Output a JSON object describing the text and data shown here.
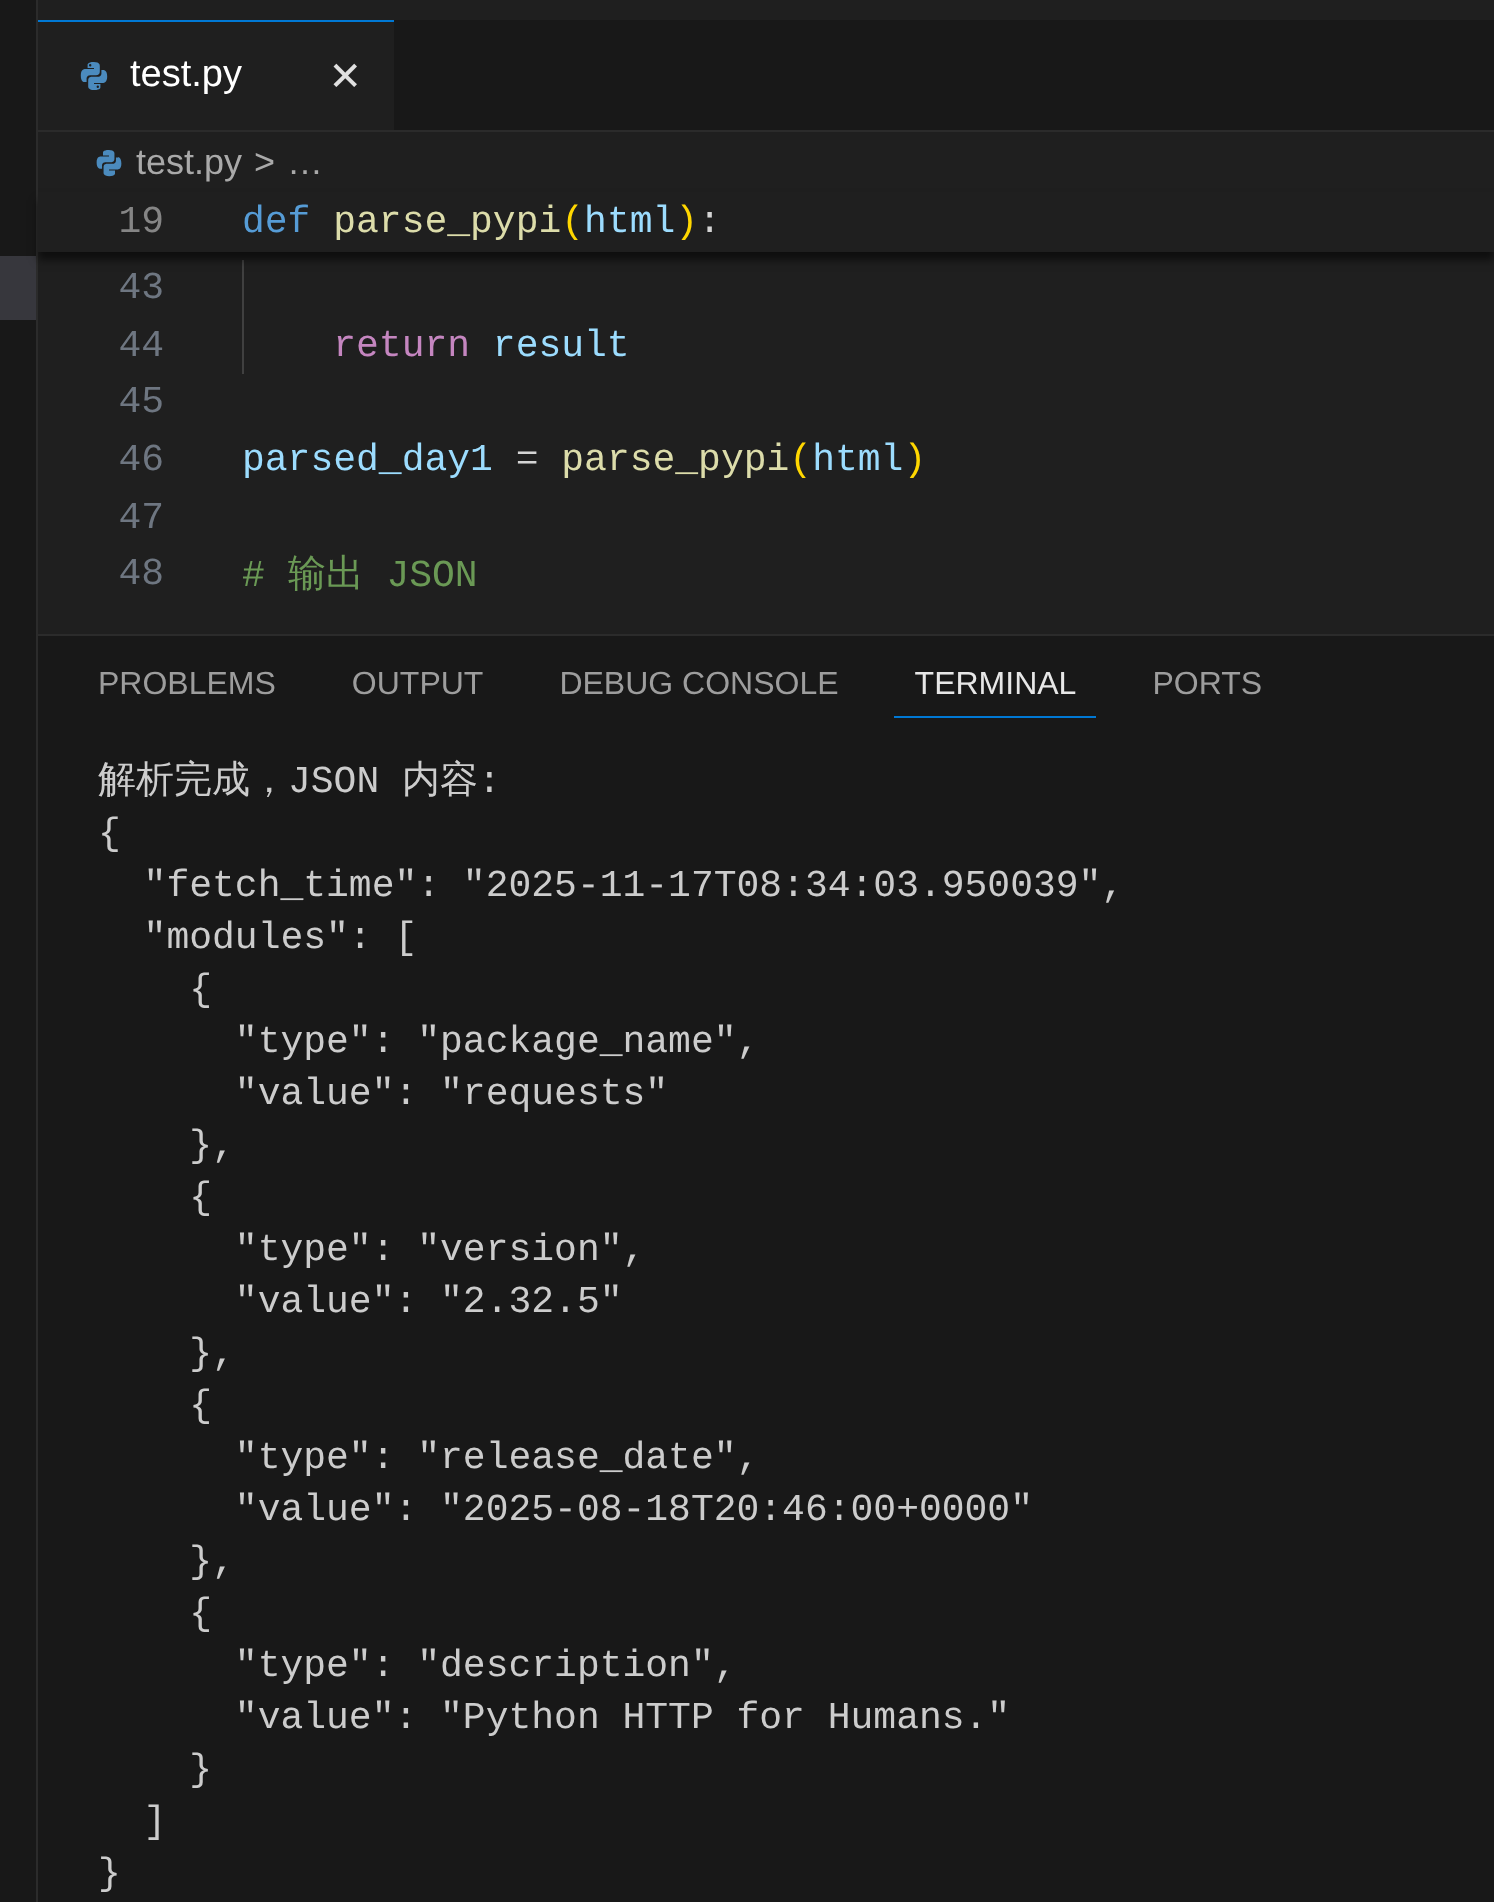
{
  "editor_tabs": [
    {
      "label": "test.py",
      "selected": true,
      "close": "✕"
    }
  ],
  "breadcrumb": {
    "file": "test.py",
    "separator": ">",
    "rest": "…"
  },
  "sticky_line": {
    "number": "19",
    "tokens": [
      {
        "text": "def ",
        "kind": "keyword"
      },
      {
        "text": "parse_pypi",
        "kind": "function"
      },
      {
        "text": "(",
        "kind": "bracket"
      },
      {
        "text": "html",
        "kind": "variable"
      },
      {
        "text": ")",
        "kind": "bracket"
      },
      {
        "text": ":",
        "kind": "plain"
      }
    ]
  },
  "code_lines": [
    {
      "number": "43",
      "indent_guide": true
    },
    {
      "number": "44",
      "indent_guide": true,
      "tokens": [
        {
          "text": "    return ",
          "kind": "control"
        },
        {
          "text": "result",
          "kind": "variable"
        }
      ]
    },
    {
      "number": "45",
      "indent_guide": false
    },
    {
      "number": "46",
      "indent_guide": false,
      "tokens": [
        {
          "text": "parsed_day1",
          "kind": "variable"
        },
        {
          "text": " = ",
          "kind": "plain"
        },
        {
          "text": "parse_pypi",
          "kind": "function"
        },
        {
          "text": "(",
          "kind": "bracket"
        },
        {
          "text": "html",
          "kind": "variable"
        },
        {
          "text": ")",
          "kind": "bracket"
        }
      ]
    },
    {
      "number": "47",
      "indent_guide": false
    },
    {
      "number": "48",
      "indent_guide": false,
      "tokens": [
        {
          "text": "# 输出 JSON",
          "kind": "comment"
        }
      ]
    }
  ],
  "panel_tabs": [
    {
      "label": "PROBLEMS",
      "selected": false
    },
    {
      "label": "OUTPUT",
      "selected": false
    },
    {
      "label": "DEBUG CONSOLE",
      "selected": false
    },
    {
      "label": "TERMINAL",
      "selected": true
    },
    {
      "label": "PORTS",
      "selected": false
    }
  ],
  "terminal_lines": [
    "解析完成，JSON 内容:",
    "{",
    "  \"fetch_time\": \"2025-11-17T08:34:03.950039\",",
    "  \"modules\": [",
    "    {",
    "      \"type\": \"package_name\",",
    "      \"value\": \"requests\"",
    "    },",
    "    {",
    "      \"type\": \"version\",",
    "      \"value\": \"2.32.5\"",
    "    },",
    "    {",
    "      \"type\": \"release_date\",",
    "      \"value\": \"2025-08-18T20:46:00+0000\"",
    "    },",
    "    {",
    "      \"type\": \"description\",",
    "      \"value\": \"Python HTTP for Humans.\"",
    "    }",
    "  ]",
    "}"
  ]
}
